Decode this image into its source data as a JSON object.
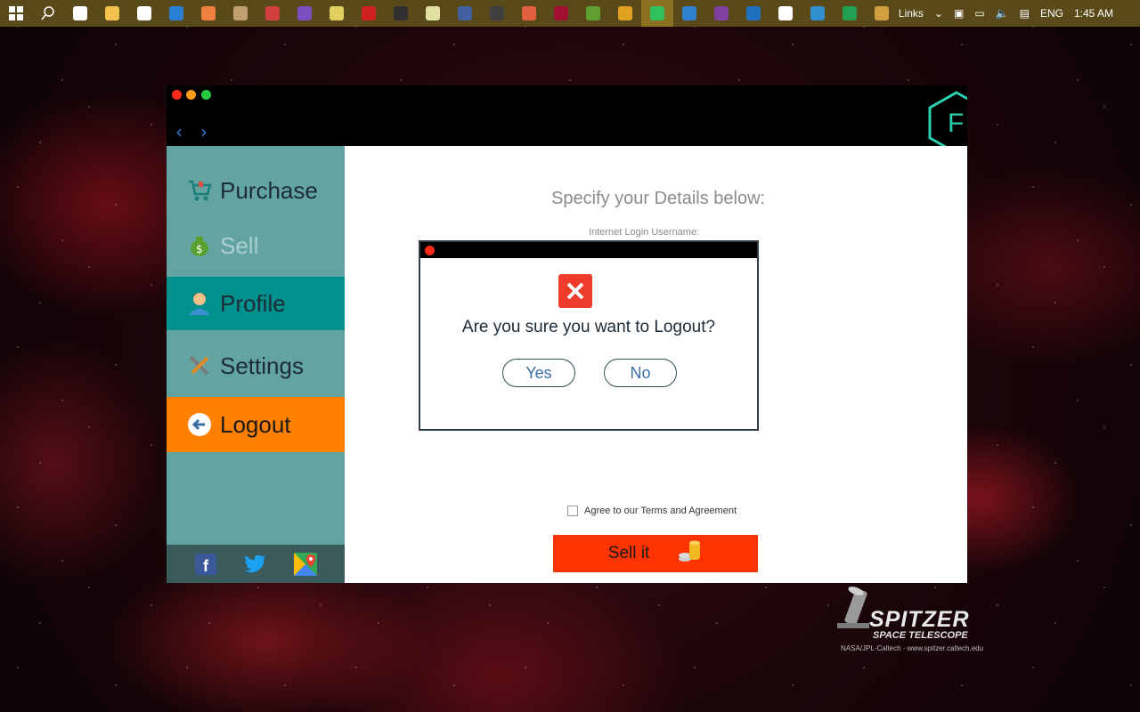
{
  "taskbar": {
    "icons": [
      {
        "name": "start-icon",
        "color": "#ffffff"
      },
      {
        "name": "search-icon",
        "color": "#ffffff"
      },
      {
        "name": "task-view-icon",
        "color": "#ffffff"
      },
      {
        "name": "file-explorer-icon",
        "color": "#f2c14e"
      },
      {
        "name": "store-icon",
        "color": "#ffffff"
      },
      {
        "name": "edge-icon",
        "color": "#2a7fd4"
      },
      {
        "name": "app-icon",
        "color": "#f08040"
      },
      {
        "name": "app-icon",
        "color": "#c0a070"
      },
      {
        "name": "app-icon",
        "color": "#d04040"
      },
      {
        "name": "visual-studio-icon",
        "color": "#7a4fc0"
      },
      {
        "name": "app-icon",
        "color": "#e0d060"
      },
      {
        "name": "filezilla-icon",
        "color": "#d02020"
      },
      {
        "name": "cmd-icon",
        "color": "#303030"
      },
      {
        "name": "notepad-icon",
        "color": "#e0e0a0"
      },
      {
        "name": "app-icon",
        "color": "#4060a0"
      },
      {
        "name": "app-icon",
        "color": "#404040"
      },
      {
        "name": "app-icon",
        "color": "#e06040"
      },
      {
        "name": "app-icon",
        "color": "#a01030"
      },
      {
        "name": "app-icon",
        "color": "#60a030"
      },
      {
        "name": "app-icon",
        "color": "#e0a020"
      },
      {
        "name": "app-icon",
        "color": "#30c060"
      },
      {
        "name": "app-icon",
        "color": "#3080d0"
      },
      {
        "name": "onenote-icon",
        "color": "#8040a0"
      },
      {
        "name": "app-icon",
        "color": "#2070c0"
      },
      {
        "name": "calculator-icon",
        "color": "#ffffff"
      },
      {
        "name": "app-icon",
        "color": "#3090d0"
      },
      {
        "name": "excel-icon",
        "color": "#20a050"
      },
      {
        "name": "app-icon",
        "color": "#d0a040"
      }
    ],
    "tray": {
      "links": "Links",
      "language": "ENG",
      "clock": "1:45 AM"
    }
  },
  "app": {
    "logo_letter": "F",
    "sidebar": {
      "items": [
        {
          "label": "Purchase",
          "icon": "cart-icon"
        },
        {
          "label": "Sell",
          "icon": "money-bag-icon"
        },
        {
          "label": "Profile",
          "icon": "user-icon"
        },
        {
          "label": "Settings",
          "icon": "tools-icon"
        },
        {
          "label": "Logout",
          "icon": "logout-icon"
        }
      ],
      "social": [
        "facebook-icon",
        "twitter-icon",
        "maps-icon"
      ]
    },
    "main": {
      "heading": "Specify your Details below:",
      "field_label": "Internet Login Username:",
      "agree_text": "Agree to our Terms and Agreement",
      "sell_button": "Sell it"
    },
    "dialog": {
      "message": "Are you sure you want to Logout?",
      "yes": "Yes",
      "no": "No"
    }
  },
  "wallpaper": {
    "title": "SPITZER",
    "subtitle": "SPACE TELESCOPE",
    "credit": "NASA/JPL-Caltech · www.spitzer.caltech.edu"
  }
}
